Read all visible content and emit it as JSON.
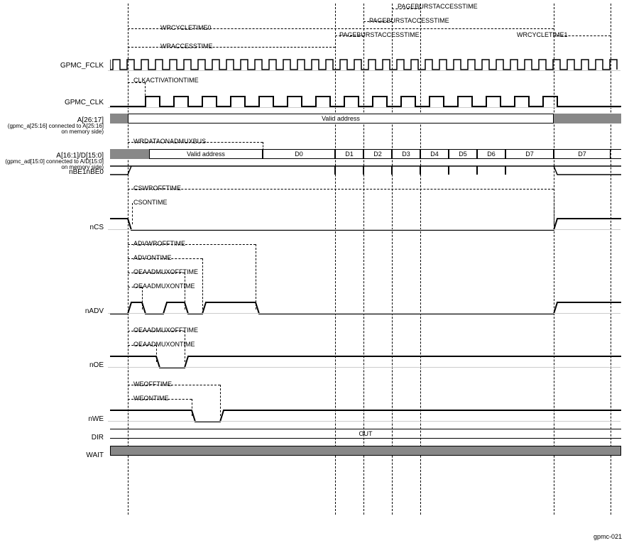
{
  "signals": {
    "fclk": "GPMC_FCLK",
    "clk": "GPMC_CLK",
    "addr_hi": "A[26:17]",
    "addr_hi_sub": "(gpmc_a[25:16] connected to A[25:16] on memory side)",
    "addr_lo": "A[16:1]/D[15:0]",
    "addr_lo_sub": "(gpmc_ad[15:0] connected to A/D[15:0] on memory side)",
    "nbe": "nBE1nBE0",
    "ncs": "nCS",
    "nadv": "nADV",
    "noe": "nOE",
    "nwe": "nWE",
    "dir": "DIR",
    "wait": "WAIT"
  },
  "annot": {
    "pageburst1": "PAGEBURSTACCESSTIME",
    "pageburst2": "PAGEBURSTACCESSTIME",
    "pageburst3": "PAGEBURSTACCESSTIME",
    "wrcycle0": "WRCYCLETIME0",
    "wrcycle1": "WRCYCLETIME1",
    "wraccess": "WRACCESSTIME",
    "clkact": "CLKACTIVATIONTIME",
    "wrdata": "WRDATAONADMUXBUS",
    "cswroff": "CSWROFFTIME",
    "cson": "CSONTIME",
    "advwroff": "ADVWROFFTIME",
    "advon": "ADVONTIME",
    "oeoff": "OEAADMUXOFFTIME",
    "oeon": "OEAADMUXONTIME",
    "oeoff2": "OEAADMUXOFFTIME",
    "oeon2": "OEAADMUXONTIME",
    "weoff": "WEOFFTIME",
    "weon": "WEONTIME"
  },
  "bus": {
    "valid_addr": "Valid address",
    "valid_addr2": "Valid address",
    "d0": "D0",
    "d1": "D1",
    "d2": "D2",
    "d3": "D3",
    "d4": "D4",
    "d5": "D5",
    "d6": "D6",
    "d7": "D7",
    "d7b": "D7",
    "out": "OUT"
  },
  "footer": "gpmc-021"
}
